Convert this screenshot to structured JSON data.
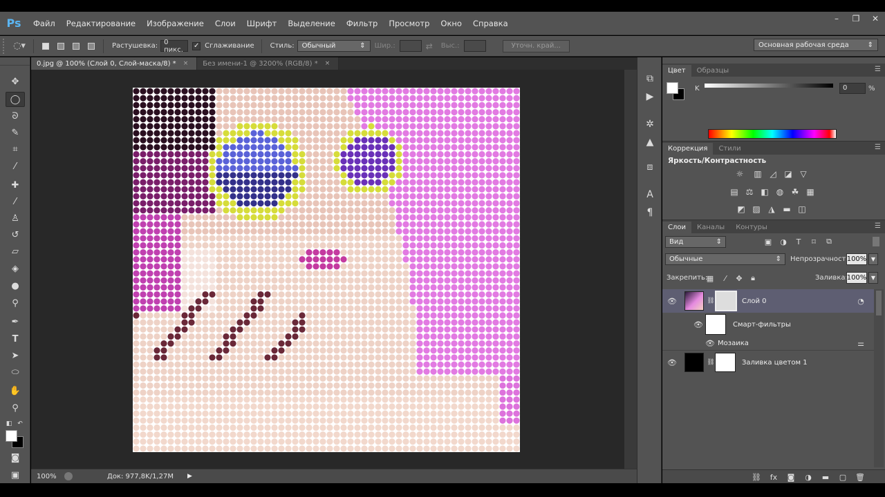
{
  "app": {
    "logo": "Ps"
  },
  "menu": [
    "Файл",
    "Редактирование",
    "Изображение",
    "Слои",
    "Шрифт",
    "Выделение",
    "Фильтр",
    "Просмотр",
    "Окно",
    "Справка"
  ],
  "window_controls": {
    "minimize": "–",
    "maximize": "❐",
    "close": "✕"
  },
  "options": {
    "feather_label": "Растушевка:",
    "feather_value": "0 пикс.",
    "antialias_label": "Сглаживание",
    "antialias_checked": "✓",
    "style_label": "Стиль:",
    "style_value": "Обычный",
    "width_label": "Шир.:",
    "height_label": "Выс.:",
    "refine_button": "Уточн. край...",
    "workspace": "Основная рабочая среда"
  },
  "tabs": [
    {
      "label": "0.jpg @ 100% (Слой 0, Слой-маска/8) *",
      "close": "×"
    },
    {
      "label": "Без имени-1 @ 3200% (RGB/8) *",
      "close": "×"
    }
  ],
  "status": {
    "zoom": "100%",
    "doc": "Док: 977,8K/1,27M",
    "arrow": "▶"
  },
  "color_panel": {
    "tabs": [
      "Цвет",
      "Образцы"
    ],
    "channel_label": "K",
    "channel_value": "0",
    "unit": "%"
  },
  "adjust_panel": {
    "tabs": [
      "Коррекция",
      "Стили"
    ],
    "hover_title": "Яркость/Контрастность"
  },
  "layers_panel": {
    "tabs": [
      "Слои",
      "Каналы",
      "Контуры"
    ],
    "filter_kind": "Вид",
    "blend_mode": "Обычные",
    "opacity_label": "Непрозрачность:",
    "opacity_value": "100%",
    "lock_label": "Закрепить:",
    "fill_label": "Заливка:",
    "fill_value": "100%",
    "layers": [
      {
        "name": "Слой 0"
      },
      {
        "name": "Смарт-фильтры"
      },
      {
        "name": "Мозаика"
      },
      {
        "name": "Заливка цветом 1"
      }
    ]
  },
  "canvas": {
    "pattern": "halftone-dots",
    "background_color": "#e070e0",
    "dot_grid": {
      "cols": 56,
      "rows": 52
    }
  },
  "colors": {
    "accent": "#5ab4f1",
    "panel_bg": "#535353",
    "workspace_bg": "#282828"
  }
}
